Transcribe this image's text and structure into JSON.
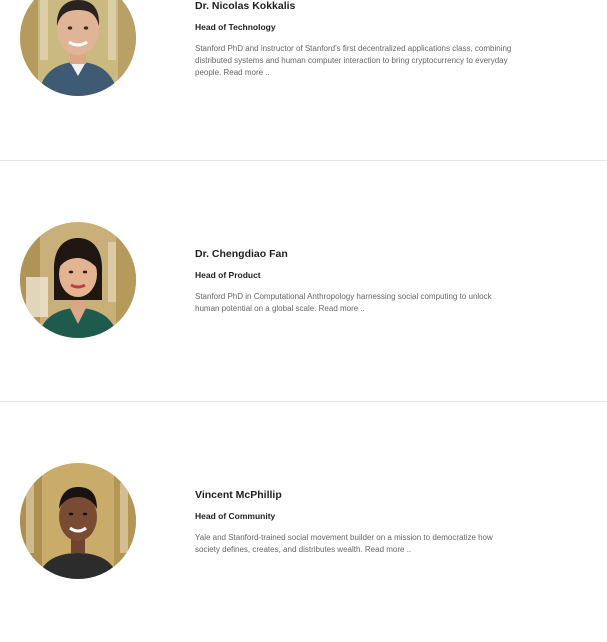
{
  "team": [
    {
      "name": "Dr. Nicolas Kokkalis",
      "role": "Head of Technology",
      "bio": "Stanford PhD and instructor of Stanford's first decentralized applications class, combining distributed systems and human computer interaction to bring cryptocurrency to everyday people.",
      "read_more": "Read more ..",
      "colors": {
        "bg": "#c9b57a",
        "skin": "#e0b497",
        "hair": "#2b231f",
        "shirt": "#3f5a73"
      }
    },
    {
      "name": "Dr. Chengdiao Fan",
      "role": "Head of Product",
      "bio": "Stanford PhD in Computational Anthropology harnessing social computing to unlock human potential on a global scale.",
      "read_more": "Read more ..",
      "colors": {
        "bg": "#c7ae74",
        "skin": "#e3b392",
        "hair": "#1f1612",
        "shirt": "#1f5b4d"
      }
    },
    {
      "name": "Vincent McPhillip",
      "role": "Head of Community",
      "bio": "Yale and Stanford-trained social movement builder on a mission to democratize how society defines, creates, and distributes wealth.",
      "read_more": "Read more ..",
      "colors": {
        "bg": "#c9ab6a",
        "skin": "#7a4b33",
        "hair": "#1a1210",
        "shirt": "#2c2c2c"
      }
    }
  ]
}
